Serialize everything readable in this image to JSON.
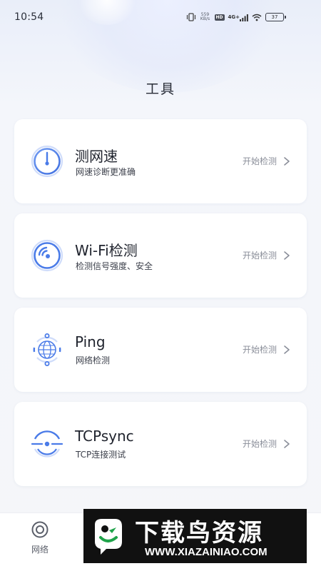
{
  "status_bar": {
    "time": "10:54",
    "net_speed_value": "559",
    "net_speed_unit": "KB/s",
    "hd_label": "HD",
    "network_type": "4G+",
    "battery_level": "37"
  },
  "header": {
    "title": "工具"
  },
  "tools": [
    {
      "title": "测网速",
      "subtitle": "网速诊断更准确",
      "action": "开始检测",
      "icon": "speedometer-icon"
    },
    {
      "title": "Wi-Fi检测",
      "subtitle": "检测信号强度、安全",
      "action": "开始检测",
      "icon": "wifi-radar-icon"
    },
    {
      "title": "Ping",
      "subtitle": "网络检测",
      "action": "开始检测",
      "icon": "globe-icon"
    },
    {
      "title": "TCPsync",
      "subtitle": "TCP连接测试",
      "action": "开始检测",
      "icon": "tcp-sync-icon"
    }
  ],
  "bottom_nav": {
    "items": [
      {
        "label": "网络",
        "icon": "network-target-icon"
      }
    ]
  },
  "watermark": {
    "title": "下载鸟资源",
    "url": "WWW.XIAZAINIAO.COM"
  },
  "colors": {
    "accent": "#4a7be8",
    "card_bg": "#ffffff",
    "page_bg": "#f5f6f9"
  }
}
